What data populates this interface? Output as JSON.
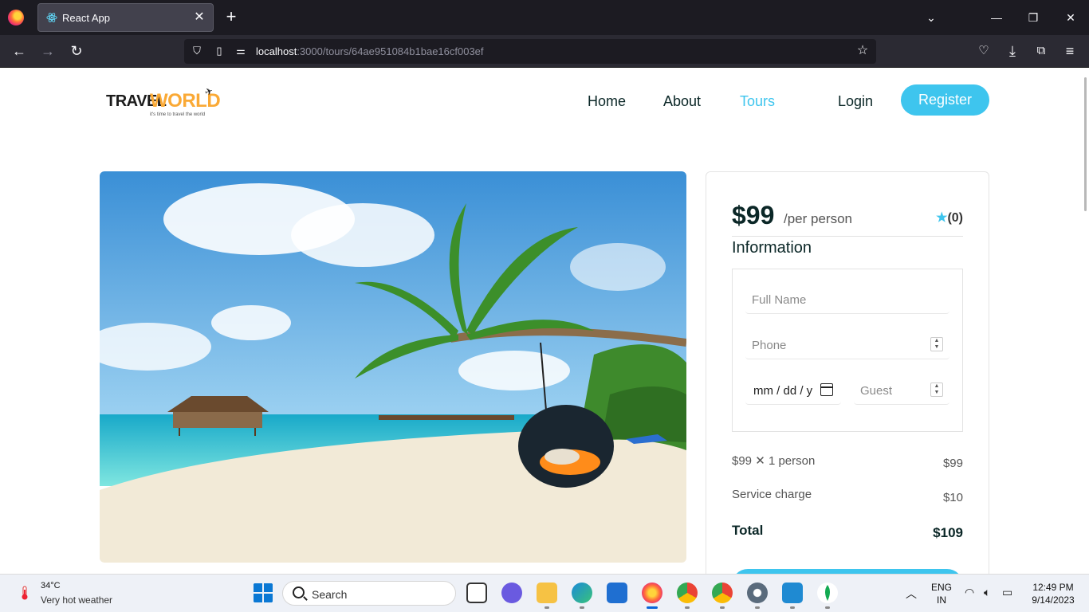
{
  "browser": {
    "tab_title": "React App",
    "url_host": "localhost",
    "url_path": ":3000/tours/64ae951084b1bae16cf003ef"
  },
  "site": {
    "logo_travel": "TRAVEL",
    "logo_world": "WORLD",
    "logo_tagline": "it's time to travel the world",
    "nav": [
      {
        "label": "Home"
      },
      {
        "label": "About"
      },
      {
        "label": "Tours",
        "active": true
      }
    ],
    "login_label": "Login",
    "register_label": "Register",
    "accent_color": "#3ec5ee"
  },
  "booking": {
    "price": "$99",
    "per_person": "/per person",
    "rating": "(0)",
    "information_title": "Information",
    "full_name_placeholder": "Full Name",
    "phone_placeholder": "Phone",
    "date_value": "mm / dd / y",
    "guest_placeholder": "Guest",
    "line_price_label": "$99",
    "line_times": "✕",
    "line_persons": "1 person",
    "line_price_total": "$99",
    "service_label": "Service charge",
    "service_value": "$10",
    "total_label": "Total",
    "total_value": "$109"
  },
  "taskbar": {
    "weather_temp": "34°C",
    "weather_desc": "Very hot weather",
    "search_label": "Search",
    "lang_line1": "ENG",
    "lang_line2": "IN",
    "time": "12:49 PM",
    "date": "9/14/2023"
  }
}
